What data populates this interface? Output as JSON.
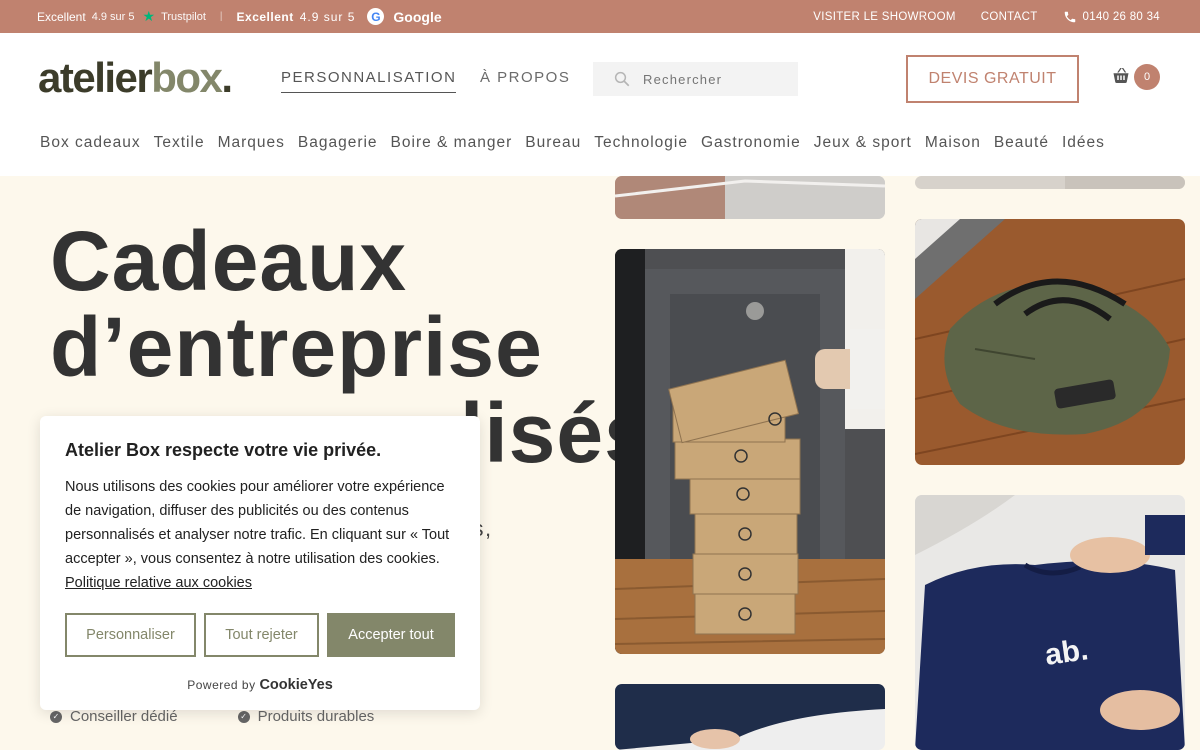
{
  "topbar": {
    "tp_label": "Excellent",
    "tp_score": "4.9 sur 5",
    "tp_brand": "Trustpilot",
    "g_label": "Excellent",
    "g_score": "4.9 sur 5",
    "g_brand": "Google",
    "showroom": "VISITER LE SHOWROOM",
    "contact": "CONTACT",
    "phone": "0140 26 80 34"
  },
  "header": {
    "logo_a": "atelier",
    "logo_b": "box",
    "logo_dot": ".",
    "nav_perso": "PERSONNALISATION",
    "nav_apropos": "À PROPOS",
    "search_placeholder": "Rechercher",
    "devis": "DEVIS GRATUIT",
    "cart_count": "0"
  },
  "categories": [
    "Box cadeaux",
    "Textile",
    "Marques",
    "Bagagerie",
    "Boire & manger",
    "Bureau",
    "Technologie",
    "Gastronomie",
    "Jeux & sport",
    "Maison",
    "Beauté",
    "Idées"
  ],
  "hero": {
    "line1": "Cadeaux",
    "line2": "d’entreprise",
    "line3": "lisés",
    "sub_fragment": "res,"
  },
  "features": [
    "Conseiller dédié",
    "Produits durables"
  ],
  "cookie": {
    "title": "Atelier Box respecte votre vie privée.",
    "body": "Nous utilisons des cookies pour améliorer votre expérience de navigation, diffuser des publicités ou des contenus personnalisés et analyser notre trafic. En cliquant sur « Tout accepter », vous consentez à notre utilisation des cookies.",
    "policy_link": "Politique relative aux cookies",
    "btn_customize": "Personnaliser",
    "btn_reject": "Tout rejeter",
    "btn_accept": "Accepter tout",
    "powered_by": "Powered by",
    "powered_brand": "CookieYes"
  },
  "colors": {
    "brand_terracotta": "#c0826f",
    "brand_olive": "#83876a",
    "hero_bg": "#fdf8ec"
  }
}
